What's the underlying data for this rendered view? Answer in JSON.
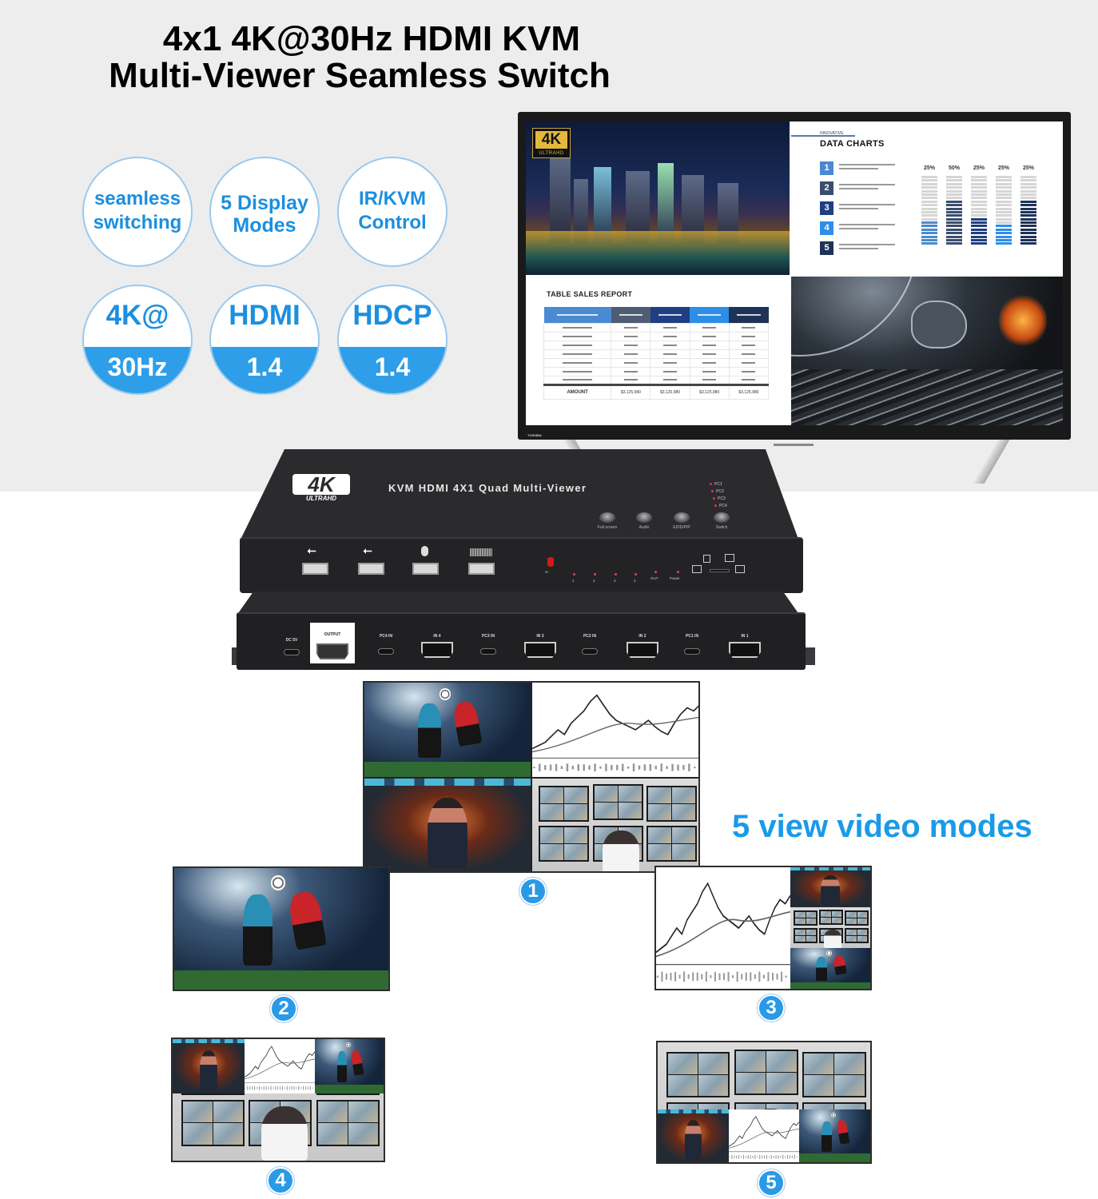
{
  "title": {
    "line1": "4x1 4K@30Hz HDMI KVM",
    "line2": "Multi-Viewer Seamless Switch"
  },
  "features": [
    {
      "id": "seamless-switching",
      "text_lines": [
        "seamless",
        "switching"
      ]
    },
    {
      "id": "display-modes",
      "text_lines": [
        "5 Display",
        "Modes"
      ]
    },
    {
      "id": "ir-kvm-control",
      "text_lines": [
        "IR/KVM",
        "Control"
      ]
    },
    {
      "id": "resolution",
      "top": "4K@",
      "bottom": "30Hz"
    },
    {
      "id": "hdmi-version",
      "top": "HDMI",
      "bottom": "1.4"
    },
    {
      "id": "hdcp-version",
      "top": "HDCP",
      "bottom": "1.4"
    }
  ],
  "colors": {
    "accent_blue": "#2e9ee9",
    "title_text": "#000000",
    "feature_text": "#1b8fe0",
    "top_background": "#ededed",
    "device_body": "#2b2b2e"
  },
  "tv": {
    "brand": "TOSHIBA",
    "logo": {
      "main": "4K",
      "sub": "ULTRAHD"
    },
    "data_charts": {
      "eyebrow": "INNOVATIVE",
      "heading": "DATA CHARTS",
      "items": [
        {
          "number": "1",
          "color": "#4a8ad0"
        },
        {
          "number": "2",
          "color": "#3a4e70"
        },
        {
          "number": "3",
          "color": "#1f3f82"
        },
        {
          "number": "4",
          "color": "#2e8ee6"
        },
        {
          "number": "5",
          "color": "#1d3358"
        }
      ],
      "bars": [
        {
          "label": "25%",
          "fill": 0.35,
          "color": "#4a8ad0"
        },
        {
          "label": "50%",
          "fill": 0.65,
          "color": "#3a4e70"
        },
        {
          "label": "25%",
          "fill": 0.4,
          "color": "#1f3f82"
        },
        {
          "label": "25%",
          "fill": 0.3,
          "color": "#2e8ee6"
        },
        {
          "label": "25%",
          "fill": 0.65,
          "color": "#1d3358"
        }
      ]
    },
    "sales_table": {
      "heading": "TABLE SALES REPORT",
      "header_colors": [
        "#4a8ad0",
        "#4e5c74",
        "#1f3f82",
        "#2e8ee6",
        "#1d3358"
      ],
      "rows": 7,
      "total_label": "AMOUNT",
      "totals": [
        "$3,125,980",
        "$3,125,980",
        "$3,125,980",
        "$3,125,980"
      ]
    }
  },
  "device": {
    "logo": {
      "main": "4K",
      "sub": "ULTRAHD"
    },
    "model": "KVM HDMI 4X1 Quad Multi-Viewer",
    "pc_indicators": [
      "PC1",
      "PC2",
      "PC3",
      "PC4"
    ],
    "buttons": [
      "Full screen",
      "Audio",
      "EDID/PIP",
      "Switch"
    ],
    "usb_ports": [
      {
        "icon": "usb-icon"
      },
      {
        "icon": "usb-icon"
      },
      {
        "icon": "mouse-icon"
      },
      {
        "icon": "keyboard-icon"
      }
    ],
    "ir_label": "IR",
    "leds": [
      "1",
      "2",
      "3",
      "4",
      "OUT",
      "Power"
    ],
    "rear_ports": {
      "power": "DC 5V",
      "output": "OUTPUT",
      "inputs": [
        {
          "usb": "PC4 IN",
          "hdmi": "IN 4"
        },
        {
          "usb": "PC3 IN",
          "hdmi": "IN 3"
        },
        {
          "usb": "PC2 IN",
          "hdmi": "IN 2"
        },
        {
          "usb": "PC1 IN",
          "hdmi": "IN 1"
        }
      ]
    }
  },
  "modes_heading": "5 view video modes",
  "modes": [
    {
      "number": "1",
      "layout": "quad 2x2"
    },
    {
      "number": "2",
      "layout": "full screen"
    },
    {
      "number": "3",
      "layout": "1 large + 3 small right"
    },
    {
      "number": "4",
      "layout": "3 small top + 1 large bottom"
    },
    {
      "number": "5",
      "layout": "1 large top + 3 small bottom"
    }
  ]
}
